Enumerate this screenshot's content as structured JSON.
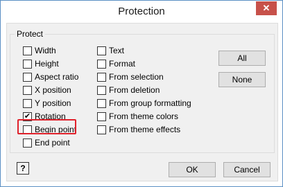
{
  "window": {
    "title": "Protection",
    "close_icon": "close-icon"
  },
  "group": {
    "label": "Protect"
  },
  "left_column": [
    {
      "label": "Width",
      "checked": false
    },
    {
      "label": "Height",
      "checked": false
    },
    {
      "label": "Aspect ratio",
      "checked": false
    },
    {
      "label": "X position",
      "checked": false
    },
    {
      "label": "Y position",
      "checked": false
    },
    {
      "label": "Rotation",
      "checked": true
    },
    {
      "label": "Begin point",
      "checked": false
    },
    {
      "label": "End point",
      "checked": false
    }
  ],
  "right_column": [
    {
      "label": "Text",
      "checked": false
    },
    {
      "label": "Format",
      "checked": false
    },
    {
      "label": "From selection",
      "checked": false
    },
    {
      "label": "From deletion",
      "checked": false
    },
    {
      "label": "From group formatting",
      "checked": false
    },
    {
      "label": "From theme colors",
      "checked": false
    },
    {
      "label": "From theme effects",
      "checked": false
    }
  ],
  "buttons": {
    "all": "All",
    "none": "None",
    "ok": "OK",
    "cancel": "Cancel",
    "help_icon": "help-icon"
  },
  "colors": {
    "highlight": "#e0212b",
    "close": "#c7514a"
  }
}
